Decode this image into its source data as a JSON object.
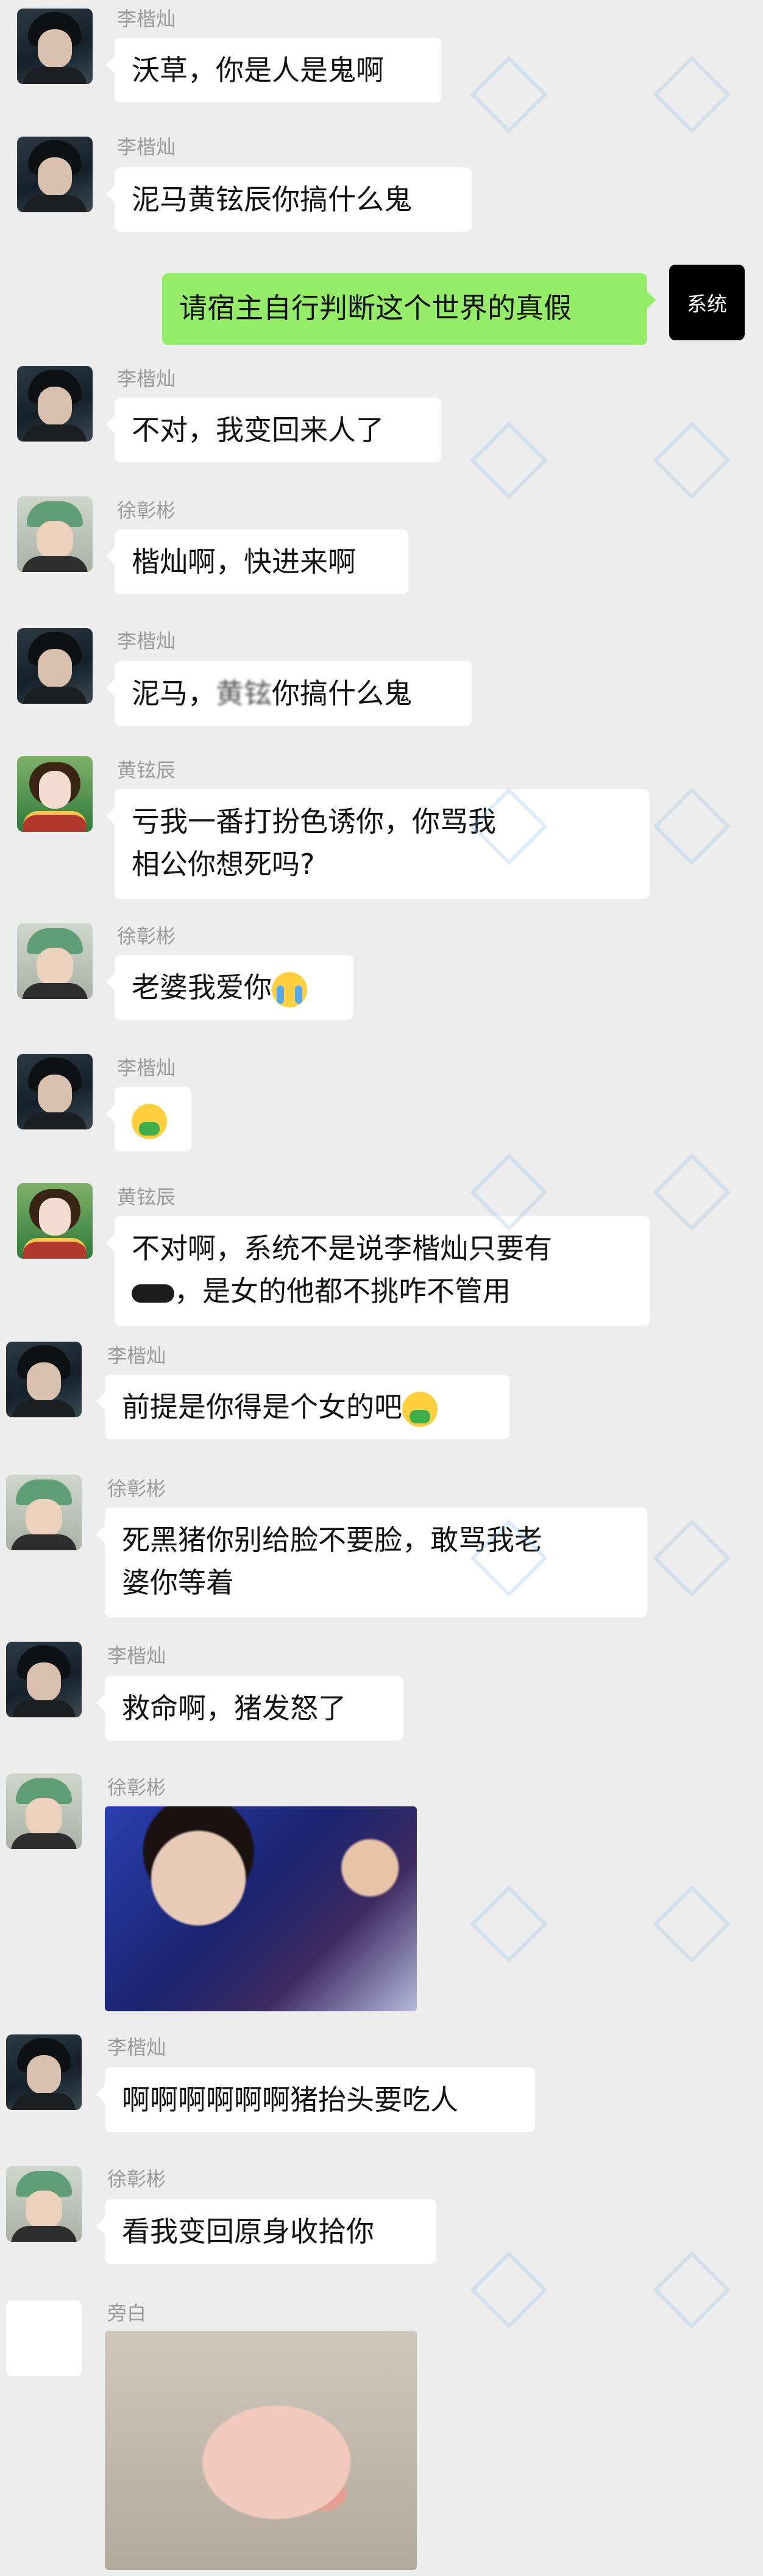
{
  "senders": {
    "li": "李楷灿",
    "xu": "徐彰彬",
    "huang": "黄铉辰",
    "narrator": "旁白",
    "system": "系统"
  },
  "messages": [
    {
      "name": "李楷灿",
      "text": "沃草，你是人是鬼啊"
    },
    {
      "name": "李楷灿",
      "text": "泥马黄铉辰你搞什么鬼"
    },
    {
      "text": "请宿主自行判断这个世界的真假",
      "avatar_label": "系统"
    },
    {
      "name": "李楷灿",
      "text": "不对，我变回来人了"
    },
    {
      "name": "徐彰彬",
      "text": "楷灿啊，快进来啊"
    },
    {
      "name": "李楷灿",
      "text_a": "泥马，",
      "blurred": "黄铉",
      "text_b": "你搞什么鬼"
    },
    {
      "name": "黄铉辰",
      "blurred": "亏我",
      "line1": "亏我一番打扮色诱你，你骂我",
      "line2": "相公你想死吗?"
    },
    {
      "name": "徐彰彬",
      "text": "老婆我爱你",
      "emoji": "loudly-crying-face"
    },
    {
      "name": "李楷灿",
      "emoji": "nauseated-face"
    },
    {
      "name": "黄铉辰",
      "line1": "不对啊，系统不是说李楷灿只要有",
      "line2": "，是女的他都不挑咋不管用"
    },
    {
      "name": "李楷灿",
      "text": "前提是你得是个女的吧",
      "emoji": "nauseated-face"
    },
    {
      "name": "徐彰彬",
      "line1": "死黑猪你别给脸不要脸，敢骂我老",
      "line2": "婆你等着"
    },
    {
      "name": "李楷灿",
      "text": "救命啊，猪发怒了"
    },
    {
      "name": "徐彰彬",
      "image": "concert-photo"
    },
    {
      "name": "李楷灿",
      "text": "啊啊啊啊啊啊猪抬头要吃人"
    },
    {
      "name": "徐彰彬",
      "text": "看我变回原身收拾你"
    },
    {
      "name": "旁白",
      "image": "pig-photo"
    }
  ],
  "colors": {
    "background": "#ededed",
    "bubble_incoming": "#ffffff",
    "bubble_outgoing": "#95ec69",
    "name_text": "#9a9a9a"
  }
}
